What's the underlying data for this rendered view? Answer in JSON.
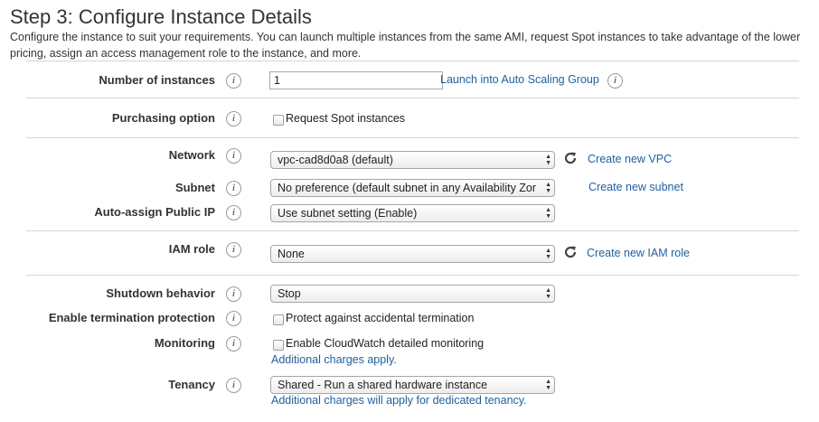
{
  "page": {
    "title": "Step 3: Configure Instance Details",
    "description": "Configure the instance to suit your requirements. You can launch multiple instances from the same AMI, request Spot instances to take advantage of the lower pricing, assign an access management role to the instance, and more."
  },
  "info_glyph": "i",
  "fields": {
    "number_of_instances": {
      "label": "Number of instances",
      "value": "1",
      "link": "Launch into Auto Scaling Group"
    },
    "purchasing_option": {
      "label": "Purchasing option",
      "checkbox_label": "Request Spot instances"
    },
    "network": {
      "label": "Network",
      "value": "vpc-cad8d0a8 (default)",
      "link": "Create new VPC"
    },
    "subnet": {
      "label": "Subnet",
      "value": "No preference (default subnet in any Availability Zon",
      "link": "Create new subnet"
    },
    "auto_assign_ip": {
      "label": "Auto-assign Public IP",
      "value": "Use subnet setting (Enable)"
    },
    "iam_role": {
      "label": "IAM role",
      "value": "None",
      "link": "Create new IAM role"
    },
    "shutdown": {
      "label": "Shutdown behavior",
      "value": "Stop"
    },
    "termination": {
      "label": "Enable termination protection",
      "checkbox_label": "Protect against accidental termination"
    },
    "monitoring": {
      "label": "Monitoring",
      "checkbox_label": "Enable CloudWatch detailed monitoring",
      "link": "Additional charges apply."
    },
    "tenancy": {
      "label": "Tenancy",
      "value": "Shared - Run a shared hardware instance",
      "link": "Additional charges will apply for dedicated tenancy."
    }
  },
  "icons": {
    "info": "info-circle-icon",
    "refresh": "refresh-icon",
    "select_arrows": "updown-arrows-icon"
  },
  "colors": {
    "link": "#1f5f9f",
    "divider": "#d5d5d5"
  }
}
